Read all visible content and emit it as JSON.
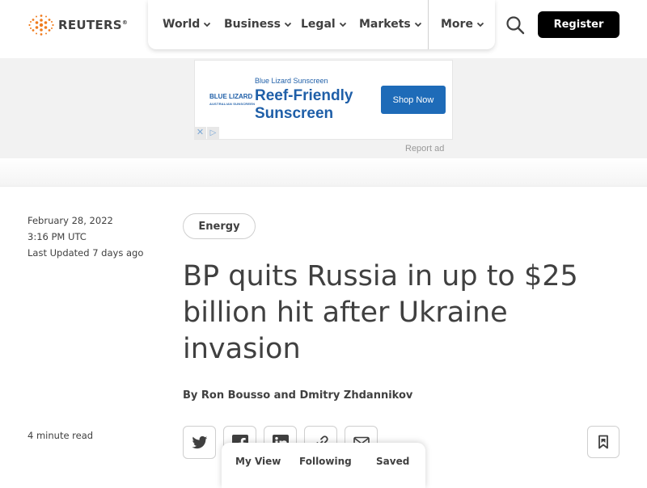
{
  "header": {
    "logo_text": "REUTERS",
    "nav": [
      {
        "label": "World"
      },
      {
        "label": "Business"
      },
      {
        "label": "Legal"
      },
      {
        "label": "Markets"
      },
      {
        "label": "More"
      }
    ],
    "register_label": "Register"
  },
  "ad": {
    "logo_line1": "BLUE LIZARD",
    "logo_line2": "AUSTRALIAN SUNSCREEN",
    "brand": "Blue Lizard Sunscreen",
    "headline": "Reef-Friendly Sunscreen",
    "cta": "Shop Now",
    "close_glyph": "✕",
    "choices_glyph": "▷",
    "report_label": "Report ad",
    "colors": {
      "brand": "#1f5fa8",
      "button": "#1e6bb8"
    }
  },
  "article": {
    "date": "February 28, 2022",
    "time": "3:16 PM UTC",
    "last_updated": "Last Updated 7 days ago",
    "tag": "Energy",
    "title": "BP quits Russia in up to $25 billion hit after Ukraine invasion",
    "byline": "By Ron Bousso and Dmitry Zhdannikov",
    "read_time": "4 minute read"
  },
  "share_icons": [
    "twitter-icon",
    "facebook-icon",
    "linkedin-icon",
    "link-icon",
    "email-icon"
  ],
  "bottom_tabs": [
    {
      "label": "My View"
    },
    {
      "label": "Following"
    },
    {
      "label": "Saved"
    }
  ]
}
